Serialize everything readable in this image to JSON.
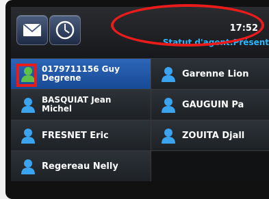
{
  "header": {
    "buttons": [
      {
        "name": "messages",
        "icon": "envelope-icon"
      },
      {
        "name": "history",
        "icon": "clock-icon"
      }
    ],
    "time": "17:52",
    "agent_status": "Statut d'agent:Présent"
  },
  "contacts": {
    "rows": [
      [
        {
          "line1": "0179711156 Guy",
          "line2": "Degrene",
          "icon": "person-icon",
          "icon_color": "#5cc04a",
          "selected": true
        },
        {
          "line1": "Garenne Lion",
          "line2": "",
          "icon": "person-icon",
          "icon_color": "#3aa4f0"
        }
      ],
      [
        {
          "line1": "BASQUIAT Jean",
          "line2": "Michel",
          "icon": "person-icon",
          "icon_color": "#3aa4f0"
        },
        {
          "line1": "GAUGUIN Pa",
          "line2": "",
          "icon": "person-icon",
          "icon_color": "#3aa4f0"
        }
      ],
      [
        {
          "line1": "FRESNET Eric",
          "line2": "",
          "icon": "person-icon",
          "icon_color": "#3aa4f0"
        },
        {
          "line1": "ZOUITA Djall",
          "line2": "",
          "icon": "person-icon",
          "icon_color": "#3aa4f0"
        }
      ],
      [
        {
          "line1": "Regereau Nelly",
          "line2": "",
          "icon": "person-icon",
          "icon_color": "#3aa4f0"
        }
      ]
    ]
  },
  "colors": {
    "accent_blue": "#2bb7ff",
    "annotation_red": "#ea1b1b",
    "selected_bg": "#2d66b8"
  }
}
